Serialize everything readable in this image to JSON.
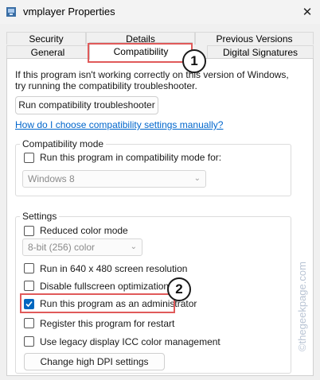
{
  "window": {
    "title": "vmplayer Properties",
    "close_glyph": "✕"
  },
  "tabs": {
    "row1": [
      "Security",
      "Details",
      "Previous Versions"
    ],
    "row2": [
      "General",
      "Compatibility",
      "Digital Signatures"
    ],
    "active": "Compatibility"
  },
  "intro_text": [
    "If this program isn't working correctly on this version of Windows,",
    "try running the compatibility troubleshooter."
  ],
  "troubleshooter_button": "Run compatibility troubleshooter",
  "help_link": "How do I choose compatibility settings manually?",
  "compat_mode": {
    "legend": "Compatibility mode",
    "checkbox_label": "Run this program in compatibility mode for:",
    "checked": false,
    "os_value": "Windows 8"
  },
  "settings": {
    "legend": "Settings",
    "reduced_color": {
      "label": "Reduced color mode",
      "checked": false
    },
    "color_value": "8-bit (256) color",
    "items": [
      {
        "label": "Run in 640 x 480 screen resolution",
        "checked": false
      },
      {
        "label": "Disable fullscreen optimizations",
        "checked": false
      },
      {
        "label": "Run this program as an administrator",
        "checked": true
      },
      {
        "label": "Register this program for restart",
        "checked": false
      },
      {
        "label": "Use legacy display ICC color management",
        "checked": false
      }
    ],
    "dpi_button": "Change high DPI settings"
  },
  "annotations": {
    "badge1": "1",
    "badge2": "2",
    "highlight_color": "#e05a5a"
  },
  "watermark": "©thegeekpage.com",
  "colors": {
    "accent": "#0067c0",
    "link": "#0066cc"
  }
}
